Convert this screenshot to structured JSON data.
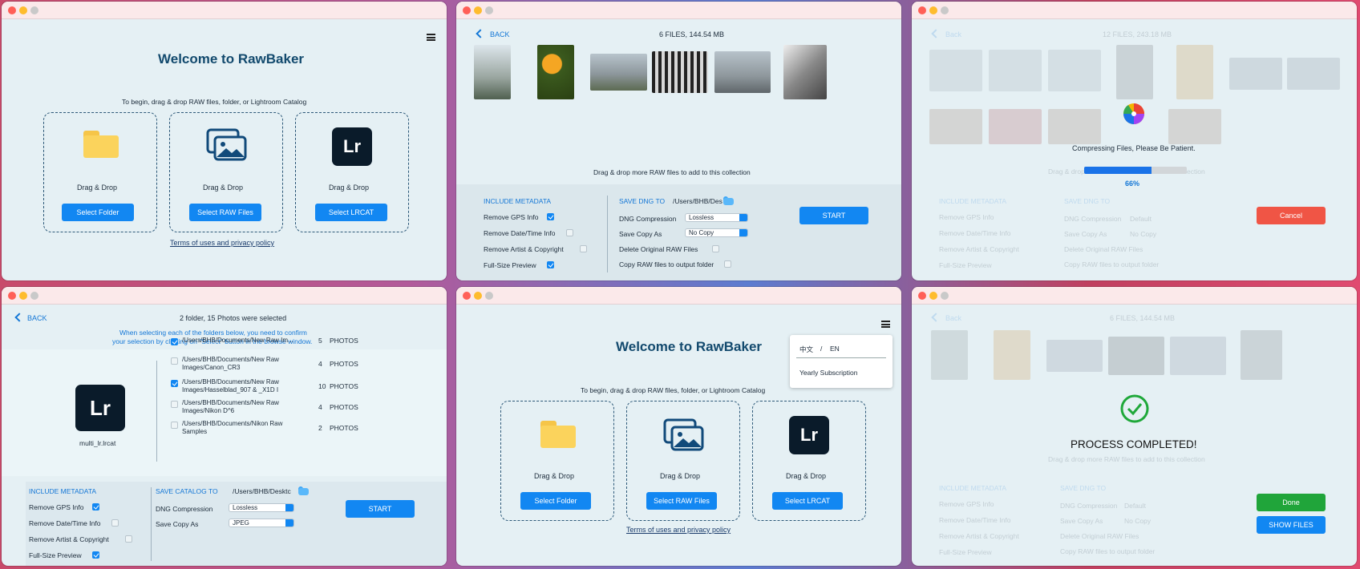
{
  "w1": {
    "title": "Welcome to RawBaker",
    "subtitle": "To begin, drag & drop RAW files, folder, or Lightroom Catalog",
    "drop1": "Drag & Drop",
    "drop2": "Drag & Drop",
    "drop3": "Drag & Drop",
    "btn_folder": "Select Folder",
    "btn_raw": "Select RAW Files",
    "btn_lrcat": "Select LRCAT",
    "lr_label": "Lr",
    "terms": "Terms of uses and privacy policy"
  },
  "w2": {
    "back": "BACK",
    "count": "6 FILES, 144.54 MB",
    "hint": "Drag & drop more RAW files to add to this collection",
    "include_metadata": "INCLUDE METADATA",
    "meta": [
      "Remove GPS Info",
      "Remove Date/Time Info",
      "Remove Artist & Copyright",
      "Full-Size Preview"
    ],
    "save_dng_to": "SAVE DNG TO",
    "path": "/Users/BHB/Des",
    "dng_compression": "DNG Compression",
    "dng_compression_value": "Lossless",
    "save_copy_as": "Save Copy As",
    "save_copy_value": "No Copy",
    "delete_original": "Delete Original RAW Files",
    "copy_raw": "Copy RAW files to output folder",
    "start": "START"
  },
  "w3": {
    "back": "Back",
    "count": "12 FILES, 243.18 MB",
    "status": "Compressing Files, Please Be Patient.",
    "progress_pct": 66,
    "progress_label": "66%",
    "drag_hint": "Drag & drop more RAW files to add to this collection",
    "cancel": "Cancel",
    "include_metadata": "INCLUDE METADATA",
    "meta": [
      "Remove GPS Info",
      "Remove Date/Time Info",
      "Remove Artist & Copyright",
      "Full-Size Preview"
    ],
    "save_dng_to": "SAVE DNG TO",
    "dng_compression": "DNG Compression",
    "dng_compression_value": "Default",
    "save_copy_as": "Save Copy As",
    "save_copy_value": "No Copy",
    "delete_original": "Delete Original RAW Files",
    "copy_raw": "Copy RAW files to output folder"
  },
  "w4": {
    "back": "BACK",
    "selected": "2 folder, 15 Photos were selected",
    "instruction1": "When selecting each of the folders below, you need to confirm",
    "instruction2": "your selection by clicking on \"Select\" button in the browse window.",
    "lr_label": "Lr",
    "catalog_name": "multi_lr.lrcat",
    "folders": [
      {
        "line1": "/Users/BHB/Documents/New Raw Im...",
        "line2": "",
        "count": "5",
        "unit": "PHOTOS"
      },
      {
        "line1": "/Users/BHB/Documents/New Raw",
        "line2": "Images/Canon_CR3",
        "count": "4",
        "unit": "PHOTOS"
      },
      {
        "line1": "/Users/BHB/Documents/New Raw",
        "line2": "Images/Hasselblad_907 & _X1D I",
        "count": "10",
        "unit": "PHOTOS"
      },
      {
        "line1": "/Users/BHB/Documents/New Raw",
        "line2": "Images/Nikon D^6",
        "count": "4",
        "unit": "PHOTOS"
      },
      {
        "line1": "/Users/BHB/Documents/Nikon Raw",
        "line2": "Samples",
        "count": "2",
        "unit": "PHOTOS"
      }
    ],
    "include_metadata": "INCLUDE METADATA",
    "meta": [
      "Remove GPS Info",
      "Remove Date/Time Info",
      "Remove Artist & Copyright",
      "Full-Size Preview"
    ],
    "save_catalog_to": "SAVE CATALOG TO",
    "path": "/Users/BHB/Desktc",
    "dng_compression": "DNG Compression",
    "dng_compression_value": "Lossless",
    "save_copy_as": "Save Copy As",
    "save_copy_value": "JPEG",
    "start": "START"
  },
  "w5": {
    "title": "Welcome to RawBaker",
    "subtitle": "To begin, drag & drop RAW files, folder, or Lightroom Catalog",
    "lang_zh": "中文",
    "lang_sep": "/",
    "lang_en": "EN",
    "yearly": "Yearly Subscription",
    "drop1": "Drag & Drop",
    "drop2": "Drag & Drop",
    "drop3": "Drag & Drop",
    "btn_folder": "Select Folder",
    "btn_raw": "Select RAW Files",
    "btn_lrcat": "Select LRCAT",
    "lr_label": "Lr",
    "terms": "Terms of uses and privacy policy"
  },
  "w6": {
    "back": "Back",
    "count": "6 FILES, 144.54 MB",
    "completed": "PROCESS COMPLETED!",
    "drag_hint": "Drag & drop more RAW files to add to this collection",
    "done": "Done",
    "show_files": "SHOW FILES",
    "include_metadata": "INCLUDE METADATA",
    "meta": [
      "Remove GPS Info",
      "Remove Date/Time Info",
      "Remove Artist & Copyright",
      "Full-Size Preview"
    ],
    "save_dng_to": "SAVE DNG TO",
    "dng_compression": "DNG Compression",
    "dng_compression_value": "Default",
    "save_copy_as": "Save Copy As",
    "save_copy_value": "No Copy",
    "delete_original": "Delete Original RAW Files",
    "copy_raw": "Copy RAW files to output folder"
  },
  "colors": {
    "accent": "#1287f2",
    "cancel": "#f05545",
    "done": "#20a53a",
    "title": "#134a6e"
  }
}
